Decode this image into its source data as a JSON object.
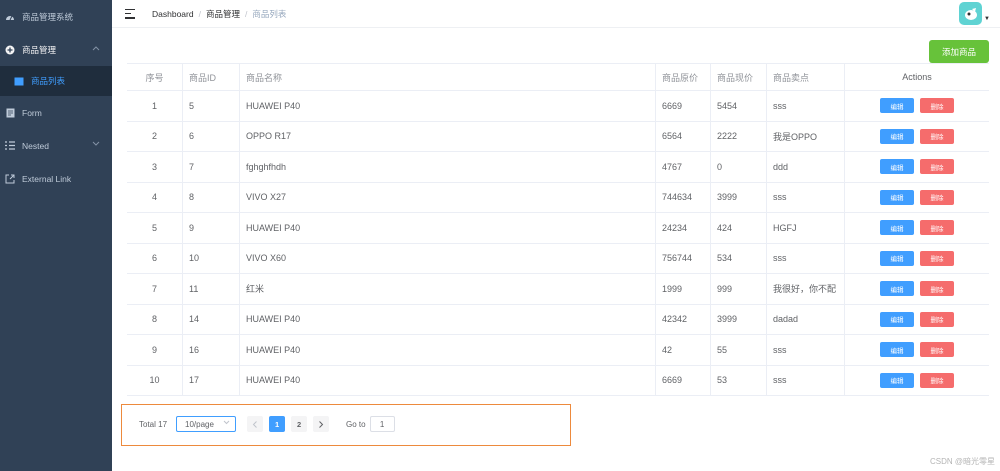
{
  "sidebar": {
    "title": "商品管理系统",
    "group": "商品管理",
    "sub_item": "商品列表",
    "items": [
      "Form",
      "Nested",
      "External Link"
    ]
  },
  "navbar": {
    "breadcrumb": [
      "Dashboard",
      "商品管理",
      "商品列表"
    ]
  },
  "toolbar": {
    "add_label": "添加商品"
  },
  "table": {
    "headers": [
      "序号",
      "商品ID",
      "商品名称",
      "商品原价",
      "商品现价",
      "商品卖点",
      "Actions"
    ],
    "rows": [
      [
        "1",
        "5",
        "HUAWEI P40",
        "6669",
        "5454",
        "sss"
      ],
      [
        "2",
        "6",
        "OPPO R17",
        "6564",
        "2222",
        "我是OPPO"
      ],
      [
        "3",
        "7",
        "fghghfhdh",
        "4767",
        "0",
        "ddd"
      ],
      [
        "4",
        "8",
        "VIVO X27",
        "744634",
        "3999",
        "sss"
      ],
      [
        "5",
        "9",
        "HUAWEI P40",
        "24234",
        "424",
        "HGFJ"
      ],
      [
        "6",
        "10",
        "VIVO X60",
        "756744",
        "534",
        "sss"
      ],
      [
        "7",
        "11",
        "红米",
        "1999",
        "999",
        "我很好，你不配"
      ],
      [
        "8",
        "14",
        "HUAWEI P40",
        "42342",
        "3999",
        "dadad"
      ],
      [
        "9",
        "16",
        "HUAWEI P40",
        "42",
        "55",
        "sss"
      ],
      [
        "10",
        "17",
        "HUAWEI P40",
        "6669",
        "53",
        "sss"
      ]
    ],
    "edit_label": "编辑",
    "delete_label": "删除"
  },
  "pagination": {
    "total": "Total 17",
    "page_size": "10/page",
    "pages": [
      "1",
      "2"
    ],
    "current_page": "1",
    "goto_label": "Go to",
    "goto_value": "1"
  },
  "watermark": "CSDN @暗光零星",
  "colors": {
    "sidebar_bg": "#304156",
    "primary": "#409eff",
    "success": "#67c23a",
    "danger": "#f56c6c",
    "highlight_box": "#ed8a3d"
  }
}
